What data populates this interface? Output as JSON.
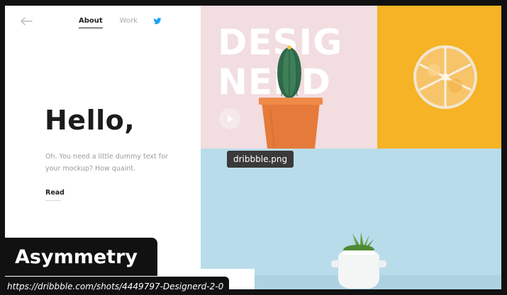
{
  "nav": {
    "back_icon": "arrow-left-icon",
    "about": "About",
    "work": "Work",
    "social_icon": "twitter-icon"
  },
  "hero": {
    "heading": "Hello,",
    "lead": "Oh. You need a little dummy text for your mockup? How quaint.",
    "read_link": "Read"
  },
  "tiles": {
    "pink_word_1": "DESIG",
    "pink_word_2": "NERD",
    "pink_bg": "#f2dde0",
    "orange_bg": "#f5b325",
    "blue_bg": "#b9dcea"
  },
  "tooltip": "dribbble.png",
  "caption": {
    "title": "Asymmetry",
    "url": "https://dribbble.com/shots/4449797-Designerd-2-0"
  }
}
